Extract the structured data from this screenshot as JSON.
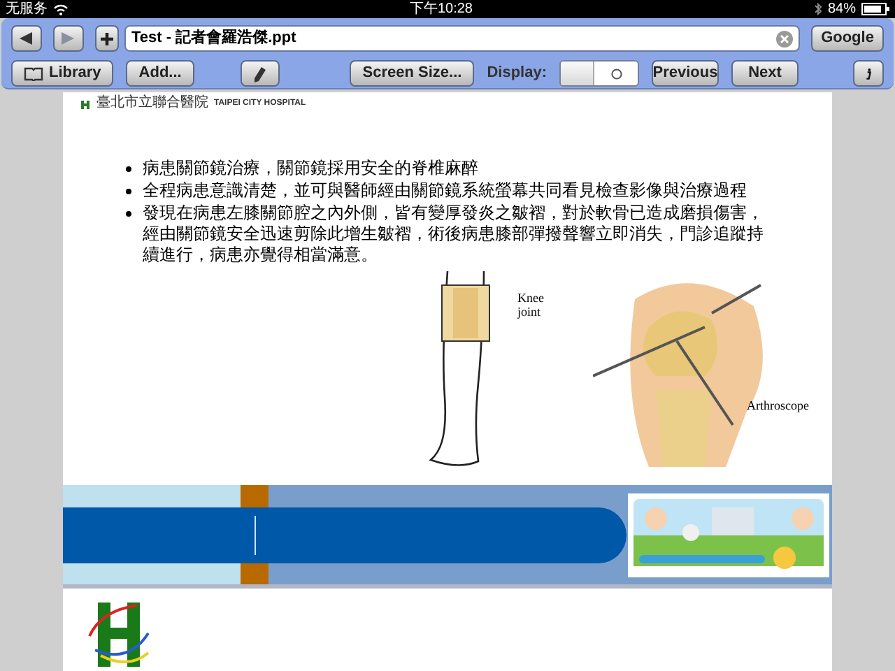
{
  "status_bar": {
    "carrier": "无服务",
    "time": "下午10:28",
    "battery": "84%"
  },
  "toolbar": {
    "back": {
      "disabled": false
    },
    "forward": {
      "disabled": true
    },
    "address": "Test - 記者會羅浩傑.ppt",
    "search_button": "Google",
    "buttons": [
      {
        "kind": "library",
        "label": "Library"
      },
      {
        "kind": "text",
        "label": "Add..."
      },
      {
        "kind": "pencil"
      },
      {
        "kind": "spacer"
      },
      {
        "kind": "text",
        "label": "Screen Size..."
      }
    ],
    "display": {
      "label": "Display:",
      "on": false
    },
    "nav_buttons": [
      "Previous",
      "Next"
    ]
  },
  "slide": {
    "logo": {
      "name": "臺北市立聯合醫院",
      "english": "TAIPEI CITY HOSPITAL"
    },
    "bullets": [
      "病患關節鏡治療，關節鏡採用安全的脊椎麻醉",
      "全程病患意識清楚，並可與醫師經由關節鏡系統螢幕共同看見檢查影像與治療過程",
      "發現在病患左膝關節腔之內外側，皆有變厚發炎之皺褶，對於軟骨已造成磨損傷害，經由關節鏡安全迅速剪除此增生皺褶，術後病患膝部彈撥聲響立即消失，門診追蹤持續進行，病患亦覺得相當滿意。"
    ],
    "figure": {
      "label_1": "Knee",
      "label_2": "joint",
      "label_3": "Arthroscope"
    }
  }
}
